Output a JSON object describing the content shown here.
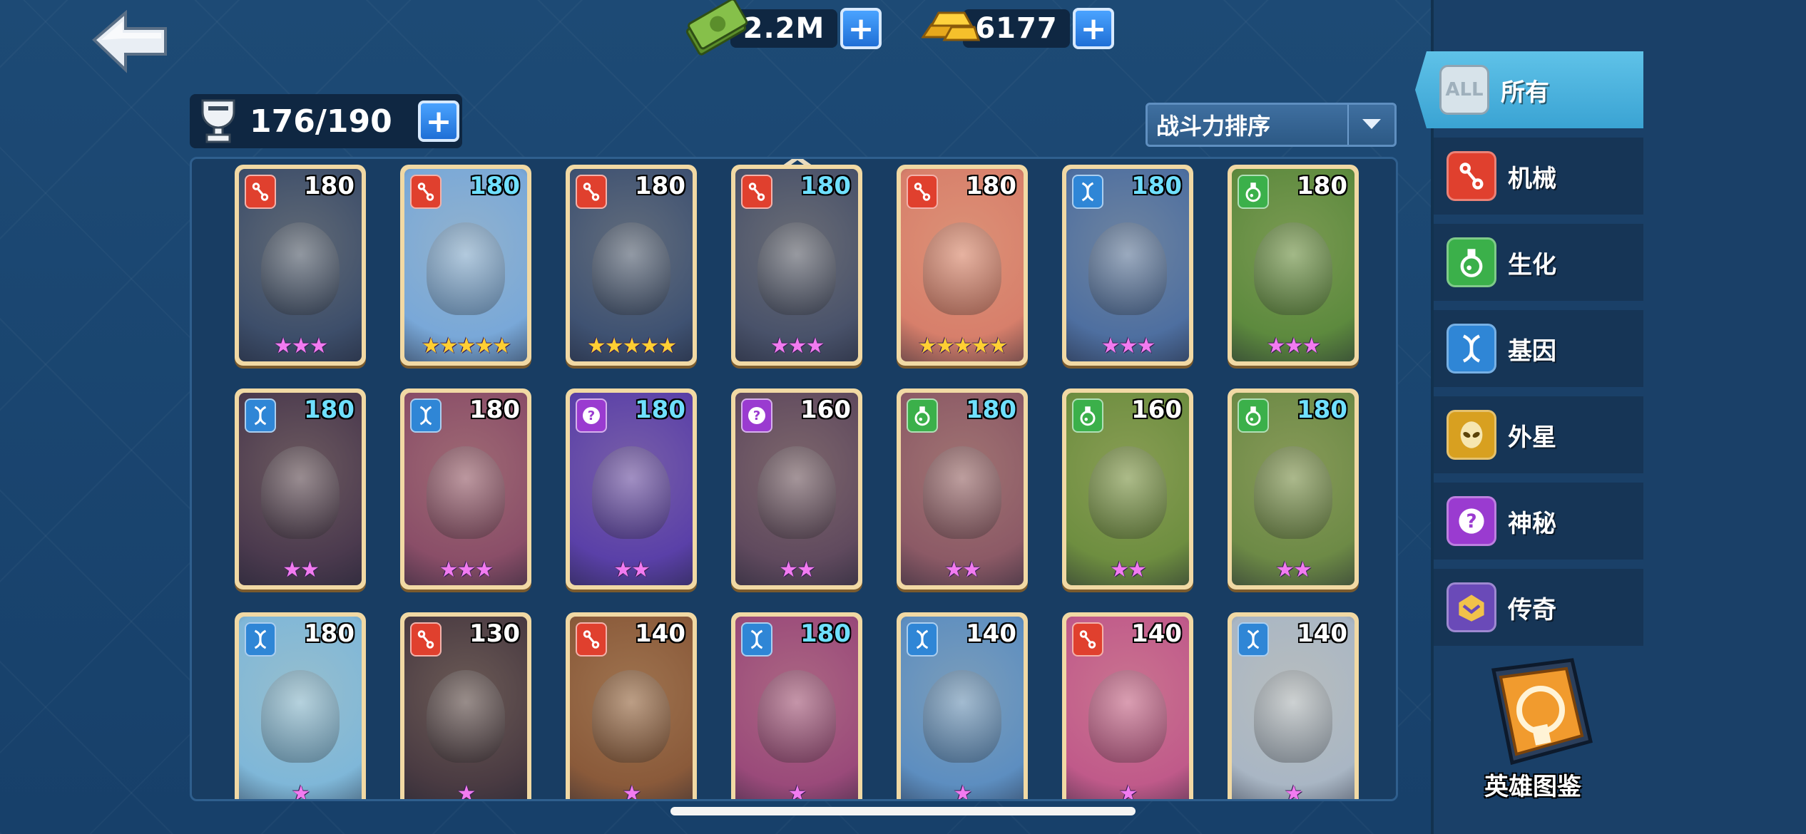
{
  "resources": {
    "cash": {
      "value": "2.2M",
      "icon": "cash-icon"
    },
    "gold": {
      "value": "6177",
      "icon": "gold-bar-icon"
    }
  },
  "capacity": {
    "value": "176/190",
    "icon": "trophy-icon"
  },
  "sort": {
    "label": "战斗力排序",
    "icon": "chevron-down-icon"
  },
  "heroes": [
    {
      "faction": "mech",
      "power": "180",
      "stars": 3,
      "star_color": "purple"
    },
    {
      "faction": "mech",
      "power": "180",
      "stars": 5,
      "star_color": "gold"
    },
    {
      "faction": "mech",
      "power": "180",
      "stars": 5,
      "star_color": "gold"
    },
    {
      "faction": "mech",
      "power": "180",
      "stars": 3,
      "star_color": "purple"
    },
    {
      "faction": "mech",
      "power": "180",
      "stars": 5,
      "star_color": "gold"
    },
    {
      "faction": "gene",
      "power": "180",
      "stars": 3,
      "star_color": "purple"
    },
    {
      "faction": "bio",
      "power": "180",
      "stars": 3,
      "star_color": "purple"
    },
    {
      "faction": "gene",
      "power": "180",
      "stars": 2,
      "star_color": "purple"
    },
    {
      "faction": "gene",
      "power": "180",
      "stars": 3,
      "star_color": "purple"
    },
    {
      "faction": "mystery",
      "power": "180",
      "stars": 2,
      "star_color": "purple"
    },
    {
      "faction": "mystery",
      "power": "160",
      "stars": 2,
      "star_color": "purple"
    },
    {
      "faction": "bio",
      "power": "180",
      "stars": 2,
      "star_color": "purple"
    },
    {
      "faction": "bio",
      "power": "160",
      "stars": 2,
      "star_color": "purple"
    },
    {
      "faction": "bio",
      "power": "180",
      "stars": 2,
      "star_color": "purple"
    },
    {
      "faction": "gene",
      "power": "180",
      "stars": 1,
      "star_color": "purple"
    },
    {
      "faction": "mech",
      "power": "130",
      "stars": 1,
      "star_color": "purple"
    },
    {
      "faction": "mech",
      "power": "140",
      "stars": 1,
      "star_color": "purple"
    },
    {
      "faction": "gene",
      "power": "180",
      "stars": 1,
      "star_color": "purple"
    },
    {
      "faction": "gene",
      "power": "140",
      "stars": 1,
      "star_color": "purple"
    },
    {
      "faction": "mech",
      "power": "140",
      "stars": 1,
      "star_color": "purple"
    },
    {
      "faction": "gene",
      "power": "140",
      "stars": 1,
      "star_color": "purple"
    }
  ],
  "factions": {
    "mech": {
      "color": "#e0402e",
      "icon": "mech-faction-icon"
    },
    "bio": {
      "color": "#3bb04a",
      "icon": "bio-faction-icon"
    },
    "gene": {
      "color": "#2f86d6",
      "icon": "gene-faction-icon"
    },
    "alien": {
      "color": "#d8a020",
      "icon": "alien-faction-icon"
    },
    "mystery": {
      "color": "#9a3bd0",
      "icon": "mystery-faction-icon"
    },
    "legend": {
      "color": "#6a4ab8",
      "icon": "legend-faction-icon"
    }
  },
  "sidebar": {
    "items": [
      {
        "key": "all",
        "label": "所有",
        "icon_text": "ALL",
        "active": true
      },
      {
        "key": "mech",
        "label": "机械",
        "icon_text": ""
      },
      {
        "key": "bio",
        "label": "生化",
        "icon_text": ""
      },
      {
        "key": "gene",
        "label": "基因",
        "icon_text": ""
      },
      {
        "key": "alien",
        "label": "外星",
        "icon_text": ""
      },
      {
        "key": "mystery",
        "label": "神秘",
        "icon_text": ""
      },
      {
        "key": "legend",
        "label": "传奇",
        "icon_text": ""
      }
    ],
    "codex_label": "英雄图鉴"
  }
}
